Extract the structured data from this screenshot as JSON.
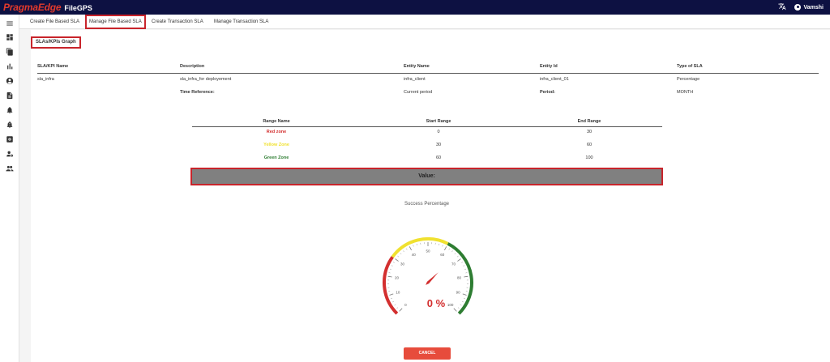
{
  "header": {
    "brand_main": "PragmaEdge",
    "brand_product": "FileGPS",
    "user_name": "Vamshi"
  },
  "tabs": [
    {
      "label": "Create File Based SLA",
      "active": false
    },
    {
      "label": "Manage File Based SLA",
      "active": true
    },
    {
      "label": "Create Transaction SLA",
      "active": false
    },
    {
      "label": "Manage Transaction SLA",
      "active": false
    }
  ],
  "sidebar_icons": [
    "menu-icon",
    "dashboard-icon",
    "files-icon",
    "bar-chart-icon",
    "account-icon",
    "document-icon",
    "bell-alert-icon",
    "alarm-icon",
    "settings-box-icon",
    "user-settings-icon",
    "people-icon"
  ],
  "section_title": "SLAs/KPIs Graph",
  "sla_table": {
    "headers": [
      "SLA/KPI Name",
      "Description",
      "Entity Name",
      "Entity Id",
      "Type of SLA"
    ],
    "row": [
      "sla_infra",
      "sla_infra_for deployement",
      "infra_client",
      "infra_client_01",
      "Percentage"
    ],
    "time_reference_label": "Time Reference:",
    "time_reference_value": "Current period",
    "period_label": "Period:",
    "period_value": "MONTH"
  },
  "range_table": {
    "headers": [
      "Range Name",
      "Start Range",
      "End Range"
    ],
    "rows": [
      {
        "name": "Red zone",
        "start": "0",
        "end": "30",
        "color": "#d32f2f"
      },
      {
        "name": "Yellow Zone",
        "start": "30",
        "end": "60",
        "color": "#f0e130"
      },
      {
        "name": "Green Zone",
        "start": "60",
        "end": "100",
        "color": "#2e7d32"
      }
    ]
  },
  "value_label": "Value:",
  "gauge": {
    "title": "Success Percentage",
    "value": 0,
    "display": "0 %",
    "min": 0,
    "max": 100,
    "tick_labels": [
      "0",
      "10",
      "20",
      "30",
      "40",
      "50",
      "60",
      "70",
      "80",
      "90",
      "100"
    ],
    "zones": [
      {
        "from": 0,
        "to": 30,
        "color": "#d32f2f"
      },
      {
        "from": 30,
        "to": 60,
        "color": "#f0e130"
      },
      {
        "from": 60,
        "to": 100,
        "color": "#2e7d32"
      }
    ]
  },
  "cancel_label": "CANCEL"
}
